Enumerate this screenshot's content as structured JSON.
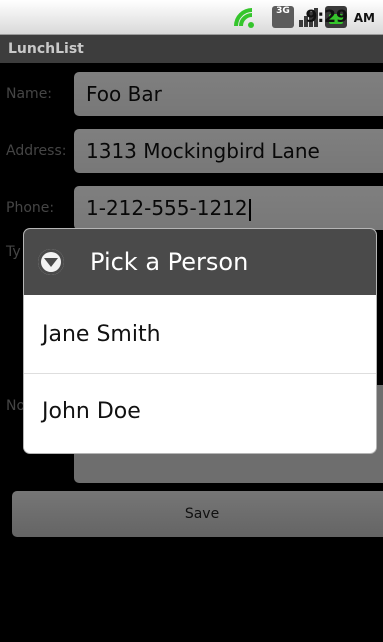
{
  "status": {
    "time": "9:29",
    "ampm": "AM",
    "network": "3G"
  },
  "app": {
    "title": "LunchList"
  },
  "form": {
    "name_label": "Name:",
    "name_value": "Foo Bar",
    "address_label": "Address:",
    "address_value": "1313 Mockingbird Lane",
    "phone_label": "Phone:",
    "phone_value": "1-212-555-1212",
    "type_label": "Ty",
    "notes_label": "No",
    "save_label": "Save"
  },
  "dialog": {
    "title": "Pick a Person",
    "items": [
      {
        "label": "Jane Smith"
      },
      {
        "label": "John Doe"
      }
    ]
  }
}
